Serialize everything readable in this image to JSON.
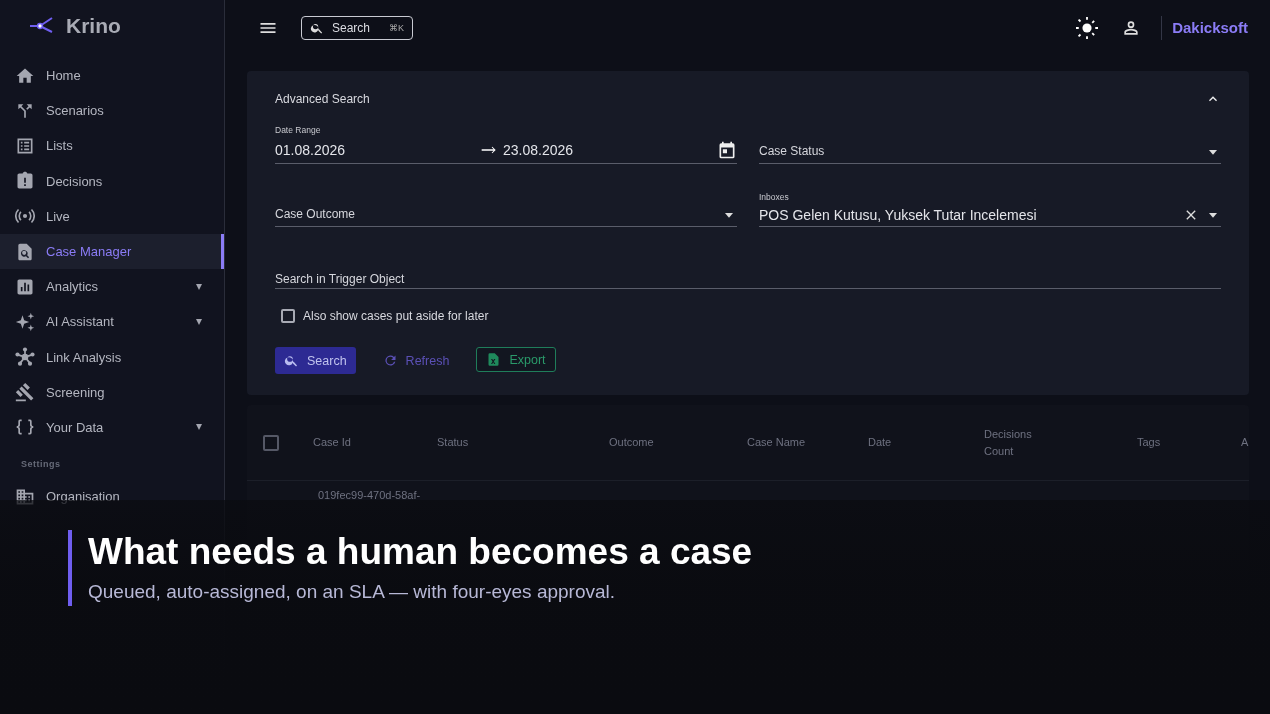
{
  "sidebar": {
    "logo": "Krino",
    "items": [
      {
        "label": "Home",
        "selected": false,
        "expandable": false
      },
      {
        "label": "Scenarios",
        "selected": false,
        "expandable": false
      },
      {
        "label": "Lists",
        "selected": false,
        "expandable": false
      },
      {
        "label": "Decisions",
        "selected": false,
        "expandable": false
      },
      {
        "label": "Live",
        "selected": false,
        "expandable": false
      },
      {
        "label": "Case Manager",
        "selected": true,
        "expandable": false
      },
      {
        "label": "Analytics",
        "selected": false,
        "expandable": true
      },
      {
        "label": "AI Assistant",
        "selected": false,
        "expandable": true
      },
      {
        "label": "Link Analysis",
        "selected": false,
        "expandable": false
      },
      {
        "label": "Screening",
        "selected": false,
        "expandable": false
      },
      {
        "label": "Your Data",
        "selected": false,
        "expandable": true
      }
    ],
    "section": "Settings",
    "settings_items": [
      {
        "label": "Organisation",
        "selected": false,
        "expandable": false
      }
    ]
  },
  "topbar": {
    "search": {
      "placeholder": "Search",
      "shortcut": "⌘K"
    },
    "organization": "Dakicksoft"
  },
  "advanced_search": {
    "title": "Advanced Search",
    "expanded": true,
    "date_range": {
      "label": "Date Range",
      "start": "01.08.2026",
      "end": "23.08.2026"
    },
    "case_status": {
      "label": "Case Status"
    },
    "case_outcome": {
      "label": "Case Outcome"
    },
    "inboxes": {
      "label": "Inboxes",
      "value": "POS Gelen Kutusu, Yuksek Tutar Incelemesi"
    },
    "trigger_object": {
      "placeholder": "Search in Trigger Object"
    },
    "put_aside": {
      "label": "Also show cases put aside for later",
      "checked": false
    },
    "buttons": [
      {
        "label": "Search",
        "kind": "primary"
      },
      {
        "label": "Refresh",
        "kind": "text"
      },
      {
        "label": "Export",
        "kind": "outlined"
      }
    ]
  },
  "table": {
    "select_all": {
      "checked": false
    },
    "columns": [
      "Case Id",
      "Status",
      "Outcome",
      "Case Name",
      "Date",
      "Decisions Count",
      "Tags",
      "A"
    ],
    "rows": [
      {
        "case_id": "019fec99-470d-58af-"
      }
    ]
  },
  "caption": {
    "title": "What needs a human becomes a case",
    "subtitle": "Queued, auto-assigned, on an SLA — with four-eyes approval."
  }
}
